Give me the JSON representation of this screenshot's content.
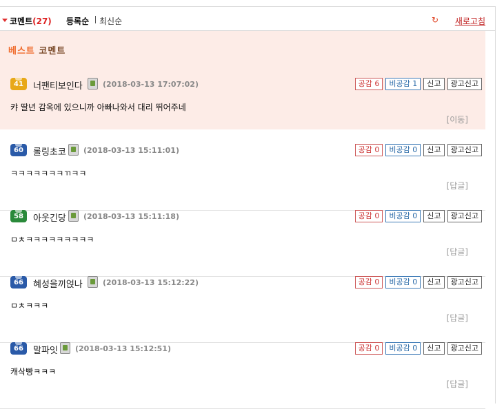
{
  "header": {
    "title": "코멘트",
    "count": "(27)",
    "sort_registered": "등록순",
    "sort_latest": "최신순",
    "refresh_icon": "↻",
    "refresh": "새로고침"
  },
  "best_section": {
    "title_part1": "베스트",
    "title_part2": "코멘트"
  },
  "comments": [
    {
      "level": "41",
      "level_color": "#e8a818",
      "nickname": "너팬티보인다",
      "date": "(2018-03-13 17:07:02)",
      "agree": "공감 6",
      "disagree": "비공감 1",
      "report": "신고",
      "ad_report": "광고신고",
      "body": "캬 딸년 감옥에 있으니까 아빠나와서 대리 뛰어주네",
      "sub": "[이동]"
    },
    {
      "level": "60",
      "level_color": "#2a5aa8",
      "nickname": "롤링초코",
      "date": "(2018-03-13 15:11:01)",
      "agree": "공감 0",
      "disagree": "비공감 0",
      "report": "신고",
      "ad_report": "광고신고",
      "body": "ㅋㅋㅋㅋㅋㅋㅋㄲㅋㅋ",
      "sub": "[답글]"
    },
    {
      "level": "58",
      "level_color": "#2a8a3a",
      "nickname": "아웃긴당",
      "date": "(2018-03-13 15:11:18)",
      "agree": "공감 0",
      "disagree": "비공감 0",
      "report": "신고",
      "ad_report": "광고신고",
      "body": "ㅁㅊㅋㅋㅋㅋㅋㅋㅋㅋㅋ",
      "sub": "[답글]"
    },
    {
      "level": "66",
      "level_color": "#2a5aa8",
      "nickname": "혜성을끼얹나",
      "date": "(2018-03-13 15:12:22)",
      "agree": "공감 0",
      "disagree": "비공감 0",
      "report": "신고",
      "ad_report": "광고신고",
      "body": "ㅁㅊㅋㅋㅋ",
      "sub": "[답글]"
    },
    {
      "level": "66",
      "level_color": "#2a5aa8",
      "nickname": "말파잇",
      "date": "(2018-03-13 15:12:51)",
      "agree": "공감 0",
      "disagree": "비공감 0",
      "report": "신고",
      "ad_report": "광고신고",
      "body": "캐삭빵ㅋㅋㅋ",
      "sub": "[답글]"
    }
  ]
}
